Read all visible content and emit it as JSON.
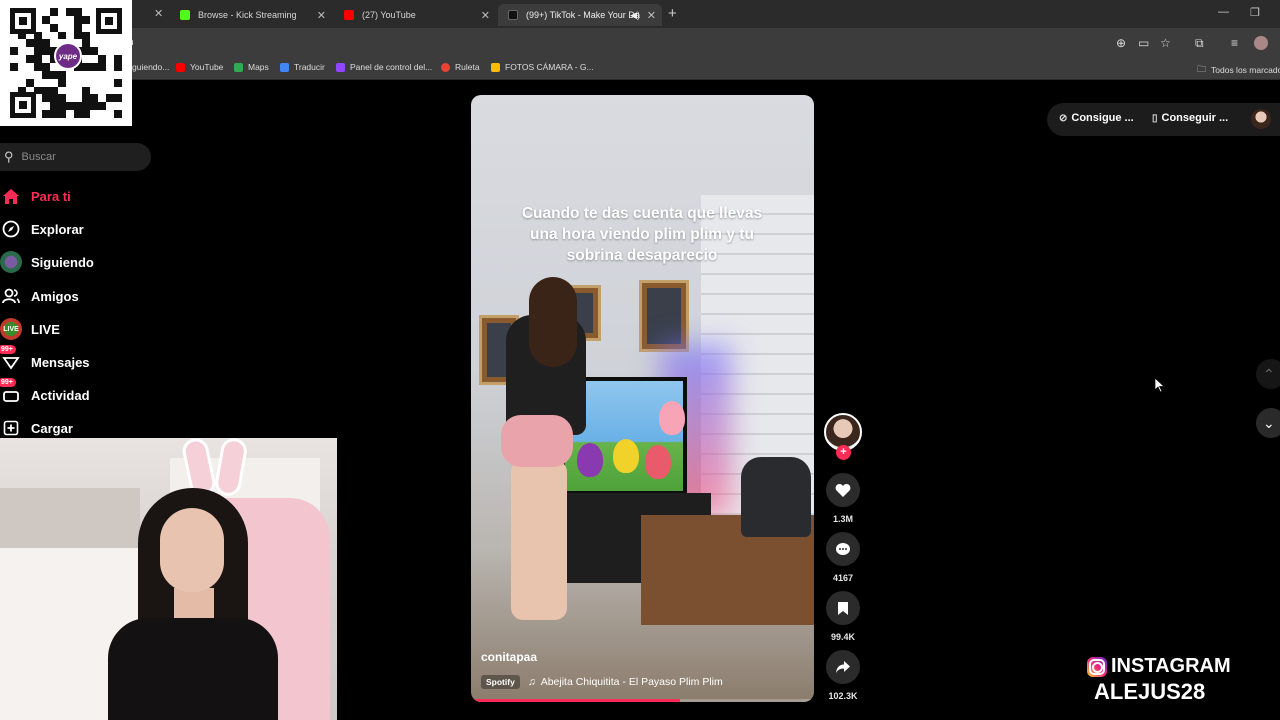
{
  "browser": {
    "tabs": [
      {
        "title": "Browse - Kick Streaming",
        "favicon_color": "#53fc18"
      },
      {
        "title": "(27) YouTube",
        "favicon_color": "#ff0000"
      },
      {
        "title": "(99+) TikTok - Make Your Da",
        "favicon_color": "#000000"
      }
    ],
    "address_fragment": "n",
    "bookmarks": [
      {
        "label": "guiendo...",
        "color": "#888888"
      },
      {
        "label": "YouTube",
        "color": "#ff0000"
      },
      {
        "label": "Maps",
        "color": "#34a853"
      },
      {
        "label": "Traducir",
        "color": "#4285f4"
      },
      {
        "label": "Panel de control del...",
        "color": "#9146ff"
      },
      {
        "label": "Ruleta",
        "color": "#ea4335"
      },
      {
        "label": "FOTOS CÁMARA - G...",
        "color": "#fbbc05"
      }
    ],
    "bookmarks_all": "Todos los marcado"
  },
  "qr": {
    "logo_text": "yape"
  },
  "sidebar": {
    "search_placeholder": "Buscar",
    "items": [
      {
        "label": "Para ti",
        "icon": "home-icon",
        "active": true
      },
      {
        "label": "Explorar",
        "icon": "compass-icon"
      },
      {
        "label": "Siguiendo",
        "icon": "following-avatar-icon"
      },
      {
        "label": "Amigos",
        "icon": "friends-icon"
      },
      {
        "label": "LIVE",
        "icon": "live-icon"
      },
      {
        "label": "Mensajes",
        "icon": "messages-icon",
        "badge": "99+"
      },
      {
        "label": "Actividad",
        "icon": "activity-icon",
        "badge": "99+"
      },
      {
        "label": "Cargar",
        "icon": "upload-icon"
      }
    ]
  },
  "video": {
    "caption": "Cuando te das cuenta que llevas una hora viendo plim plim y tu sobrina desaparecio",
    "author": "conitapaa",
    "music_source": "Spotify",
    "music_title": "Abejita Chiquitita - El Payaso Plim Plim",
    "progress": 0.61
  },
  "actions": {
    "likes": "1.3M",
    "comments": "4167",
    "saves": "99.4K",
    "shares": "102.3K"
  },
  "topright": {
    "coins_label": "Consigue ...",
    "app_label": "Conseguir ..."
  },
  "overlay": {
    "instagram_label": "INSTAGRAM",
    "instagram_user": "ALEJUS28"
  },
  "colors": {
    "accent": "#fe2c55"
  }
}
